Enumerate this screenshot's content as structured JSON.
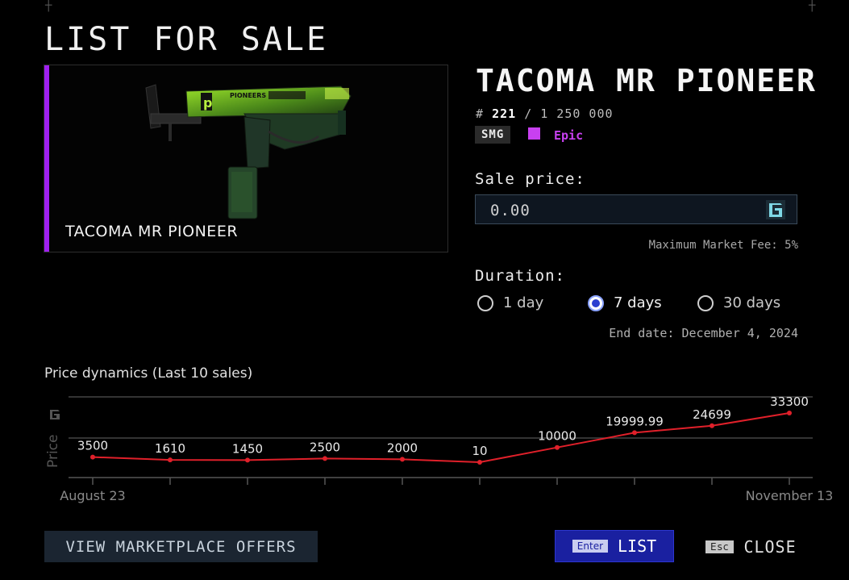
{
  "dialog": {
    "title": "LIST FOR SALE"
  },
  "item": {
    "card_name": "TACOMA MR PIONEER",
    "name": "TACOMA MR PIONEER",
    "serial_prefix": "#",
    "serial_number": "221",
    "serial_total": "/ 1 250 000",
    "type": "SMG",
    "rarity": "Epic",
    "rarity_color": "#c840f0",
    "accent_color": "#a020f0",
    "weapon_decal": "PIONEERS"
  },
  "sale": {
    "label": "Sale price:",
    "value": "0.00",
    "currency_icon": "gala-currency-icon",
    "fee": "Maximum Market Fee: 5%"
  },
  "duration": {
    "label": "Duration:",
    "options": [
      {
        "label": "1 day",
        "selected": false
      },
      {
        "label": "7 days",
        "selected": true
      },
      {
        "label": "30 days",
        "selected": false
      }
    ],
    "end_date": "End date: December 4, 2024"
  },
  "chart_title": "Price dynamics (Last 10 sales)",
  "chart_data": {
    "type": "line",
    "title": "Price dynamics (Last 10 sales)",
    "ylabel": "Price",
    "series": [
      {
        "values": [
          3500,
          1610,
          1450,
          2500,
          2000,
          10,
          10000,
          19999.99,
          24699,
          33300
        ]
      }
    ],
    "labels": [
      "3500",
      "1610",
      "1450",
      "2500",
      "2000",
      "10",
      "10000",
      "19999.99",
      "24699",
      "33300"
    ],
    "x_start_label": "August 23",
    "x_end_label": "November 13",
    "line_color": "#e0202a",
    "grid": true
  },
  "buttons": {
    "offers": "VIEW MARKETPLACE OFFERS",
    "list_key": "Enter",
    "list": "LIST",
    "close_key": "Esc",
    "close": "CLOSE"
  }
}
